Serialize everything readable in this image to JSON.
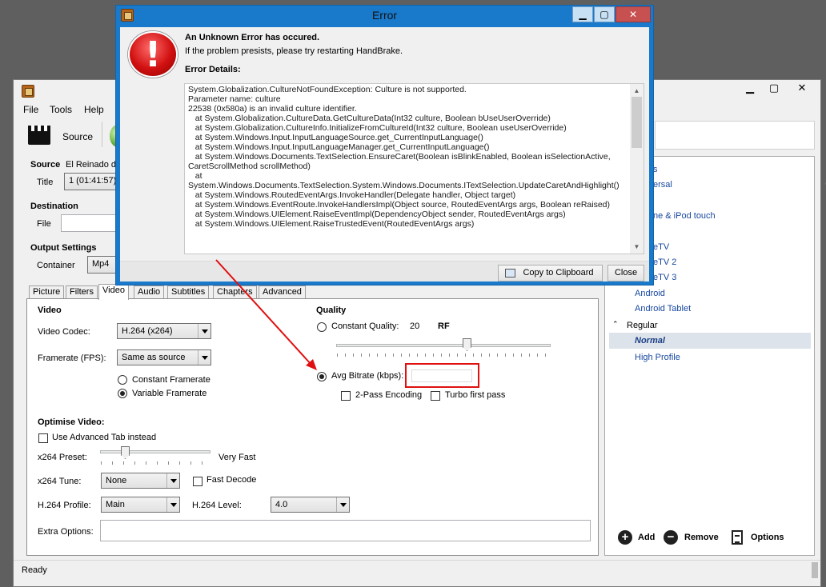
{
  "main": {
    "menu": [
      "File",
      "Tools",
      "Help"
    ],
    "toolbar": {
      "source_label": "Source"
    },
    "source": {
      "heading": "Source",
      "name": "El Reinado d",
      "title_label": "Title",
      "title_value": "1 (01:41:57)"
    },
    "destination": {
      "heading": "Destination",
      "file_label": "File"
    },
    "output": {
      "heading": "Output Settings",
      "container_label": "Container",
      "container_value": "Mp4"
    },
    "tabs": [
      "Picture",
      "Filters",
      "Video",
      "Audio",
      "Subtitles",
      "Chapters",
      "Advanced"
    ],
    "active_tab": "Video",
    "video": {
      "heading": "Video",
      "codec_label": "Video Codec:",
      "codec_value": "H.264 (x264)",
      "framerate_label": "Framerate (FPS):",
      "framerate_value": "Same as source",
      "constant_framerate": "Constant Framerate",
      "variable_framerate": "Variable Framerate"
    },
    "quality": {
      "heading": "Quality",
      "constant_quality": "Constant Quality:",
      "cq_value": "20",
      "cq_unit": "RF",
      "avg_bitrate": "Avg Bitrate (kbps):",
      "two_pass": "2-Pass Encoding",
      "turbo": "Turbo first pass"
    },
    "optimise": {
      "heading": "Optimise Video:",
      "use_advanced": "Use Advanced Tab instead",
      "preset_label": "x264 Preset:",
      "preset_value": "Very Fast",
      "tune_label": "x264 Tune:",
      "tune_value": "None",
      "fast_decode": "Fast Decode",
      "profile_label": "H.264 Profile:",
      "profile_value": "Main",
      "level_label": "H.264 Level:",
      "level_value": "4.0",
      "extra_label": "Extra Options:"
    },
    "presets": {
      "items": [
        {
          "label": "s",
          "top": 0
        },
        {
          "label": "ersal",
          "top": 0
        },
        {
          "label": "ne & iPod touch",
          "top": 0
        },
        {
          "label": "eTV",
          "top": 0
        },
        {
          "label": "eTV 2",
          "top": 0
        },
        {
          "label": "eTV 3",
          "top": 0
        },
        {
          "label": "Android",
          "top": 0
        },
        {
          "label": "Android Tablet",
          "top": 0
        }
      ],
      "group": "Regular",
      "selected": "Normal",
      "high_profile": "High Profile"
    },
    "preset_actions": {
      "add": "Add",
      "remove": "Remove",
      "options": "Options"
    },
    "status": "Ready"
  },
  "error_dialog": {
    "title": "Error",
    "headline": "An Unknown Error has occured.",
    "subline": "If the problem presists, please try restarting HandBrake.",
    "details_label": "Error Details:",
    "details_text": "System.Globalization.CultureNotFoundException: Culture is not supported.\nParameter name: culture\n22538 (0x580a) is an invalid culture identifier.\n   at System.Globalization.CultureData.GetCultureData(Int32 culture, Boolean bUseUserOverride)\n   at System.Globalization.CultureInfo.InitializeFromCultureId(Int32 culture, Boolean useUserOverride)\n   at System.Windows.Input.InputLanguageSource.get_CurrentInputLanguage()\n   at System.Windows.Input.InputLanguageManager.get_CurrentInputLanguage()\n   at System.Windows.Documents.TextSelection.EnsureCaret(Boolean isBlinkEnabled, Boolean isSelectionActive, CaretScrollMethod scrollMethod)\n   at System.Windows.Documents.TextSelection.System.Windows.Documents.ITextSelection.UpdateCaretAndHighlight()\n   at System.Windows.RoutedEventArgs.InvokeHandler(Delegate handler, Object target)\n   at System.Windows.EventRoute.InvokeHandlersImpl(Object source, RoutedEventArgs args, Boolean reRaised)\n   at System.Windows.UIElement.RaiseEventImpl(DependencyObject sender, RoutedEventArgs args)\n   at System.Windows.UIElement.RaiseTrustedEvent(RoutedEventArgs args)",
    "copy_button": "Copy to Clipboard",
    "close_button": "Close"
  },
  "colors": {
    "accent": "#1979ca",
    "highlight": "#e01010",
    "link": "#1848a0"
  }
}
